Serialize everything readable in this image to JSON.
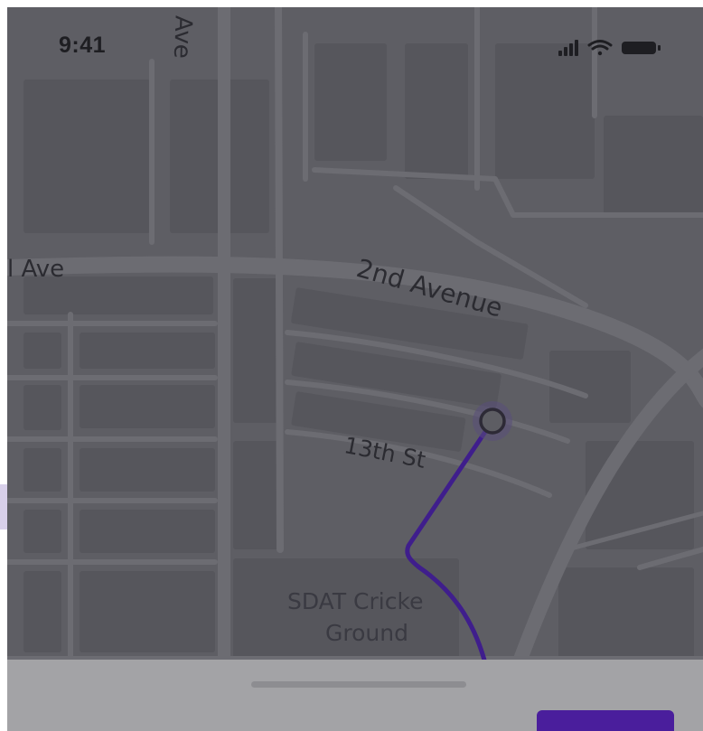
{
  "status_bar": {
    "time": "9:41",
    "icons": [
      "cellular-signal-icon",
      "wifi-icon",
      "battery-icon"
    ]
  },
  "map": {
    "street_labels": {
      "ave_top": "Ave",
      "ave_left": "l Ave",
      "second_avenue": "2nd Avenue",
      "thirteenth_st": "13th St",
      "sdat_line1": "SDAT Cricke",
      "sdat_line2": "Ground"
    },
    "route_color": "#3f1e8c",
    "destination_marker_color": "#3f1e8c"
  },
  "bottom_sheet": {
    "title": "",
    "action_label": ""
  },
  "colors": {
    "map_background": "#5e5e64",
    "sheet_background": "#a3a3a6",
    "accent": "#4a1e9c"
  }
}
